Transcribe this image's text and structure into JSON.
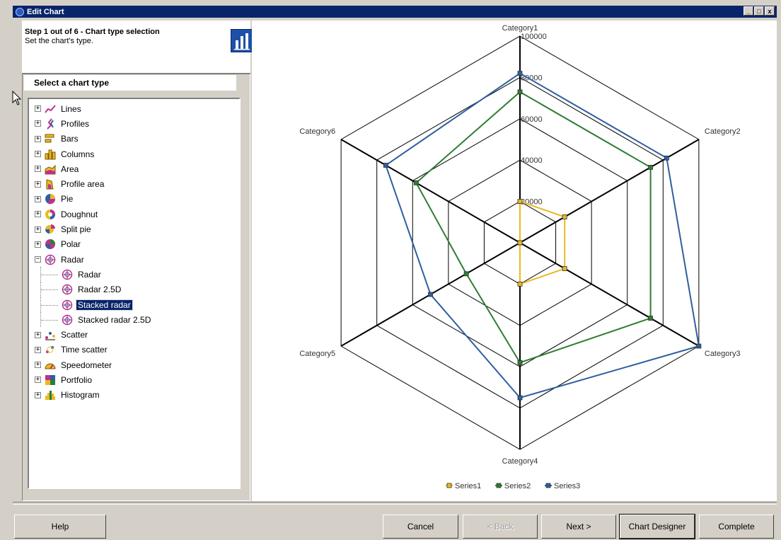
{
  "window": {
    "title": "Edit Chart",
    "controls": [
      "_",
      "□",
      "x"
    ]
  },
  "step": {
    "title": "Step 1 out of 6 - Chart type selection",
    "subtitle": "Set the chart's type."
  },
  "tree": {
    "header": "Select a chart type",
    "items": [
      {
        "label": "Lines",
        "icon": "lines-icon",
        "expander": "+"
      },
      {
        "label": "Profiles",
        "icon": "profiles-icon",
        "expander": "+"
      },
      {
        "label": "Bars",
        "icon": "bars-icon",
        "expander": "+"
      },
      {
        "label": "Columns",
        "icon": "columns-icon",
        "expander": "+"
      },
      {
        "label": "Area",
        "icon": "area-icon",
        "expander": "+"
      },
      {
        "label": "Profile area",
        "icon": "profile-area-icon",
        "expander": "+"
      },
      {
        "label": "Pie",
        "icon": "pie-icon",
        "expander": "+"
      },
      {
        "label": "Doughnut",
        "icon": "doughnut-icon",
        "expander": "+"
      },
      {
        "label": "Split pie",
        "icon": "split-pie-icon",
        "expander": "+"
      },
      {
        "label": "Polar",
        "icon": "polar-icon",
        "expander": "+"
      },
      {
        "label": "Radar",
        "icon": "radar-icon",
        "expander": "−",
        "expanded": true
      },
      {
        "label": "Radar",
        "icon": "radar-icon",
        "child": true
      },
      {
        "label": "Radar 2.5D",
        "icon": "radar-icon",
        "child": true
      },
      {
        "label": "Stacked radar",
        "icon": "radar-icon",
        "child": true,
        "selected": true
      },
      {
        "label": "Stacked radar 2.5D",
        "icon": "radar-icon",
        "child": true
      },
      {
        "label": "Scatter",
        "icon": "scatter-icon",
        "expander": "+"
      },
      {
        "label": "Time scatter",
        "icon": "time-scatter-icon",
        "expander": "+"
      },
      {
        "label": "Speedometer",
        "icon": "speedometer-icon",
        "expander": "+"
      },
      {
        "label": "Portfolio",
        "icon": "portfolio-icon",
        "expander": "+"
      },
      {
        "label": "Histogram",
        "icon": "histogram-icon",
        "expander": "+"
      }
    ]
  },
  "buttons": {
    "help": "Help",
    "cancel": "Cancel",
    "back": "< Back",
    "next": "Next >",
    "designer": "Chart Designer",
    "complete": "Complete"
  },
  "colors": {
    "series1": "#e8b923",
    "series2": "#2e7d32",
    "series3": "#2f5fa0",
    "titlebar": "#0a246a"
  },
  "chart_data": {
    "type": "radar",
    "stacked": true,
    "categories": [
      "Category1",
      "Category2",
      "Category3",
      "Category4",
      "Category5",
      "Category6"
    ],
    "tick_labels": [
      "20000",
      "40000",
      "60000",
      "80000",
      "100000"
    ],
    "ylim": [
      0,
      100000
    ],
    "series": [
      {
        "name": "Series1",
        "values": [
          20000,
          25000,
          25000,
          20000,
          0,
          0
        ]
      },
      {
        "name": "Series2",
        "values": [
          73000,
          73000,
          73000,
          58000,
          30000,
          58000
        ]
      },
      {
        "name": "Series3",
        "values": [
          82000,
          82000,
          100000,
          75000,
          50000,
          75000
        ]
      }
    ],
    "legend": "bottom"
  }
}
